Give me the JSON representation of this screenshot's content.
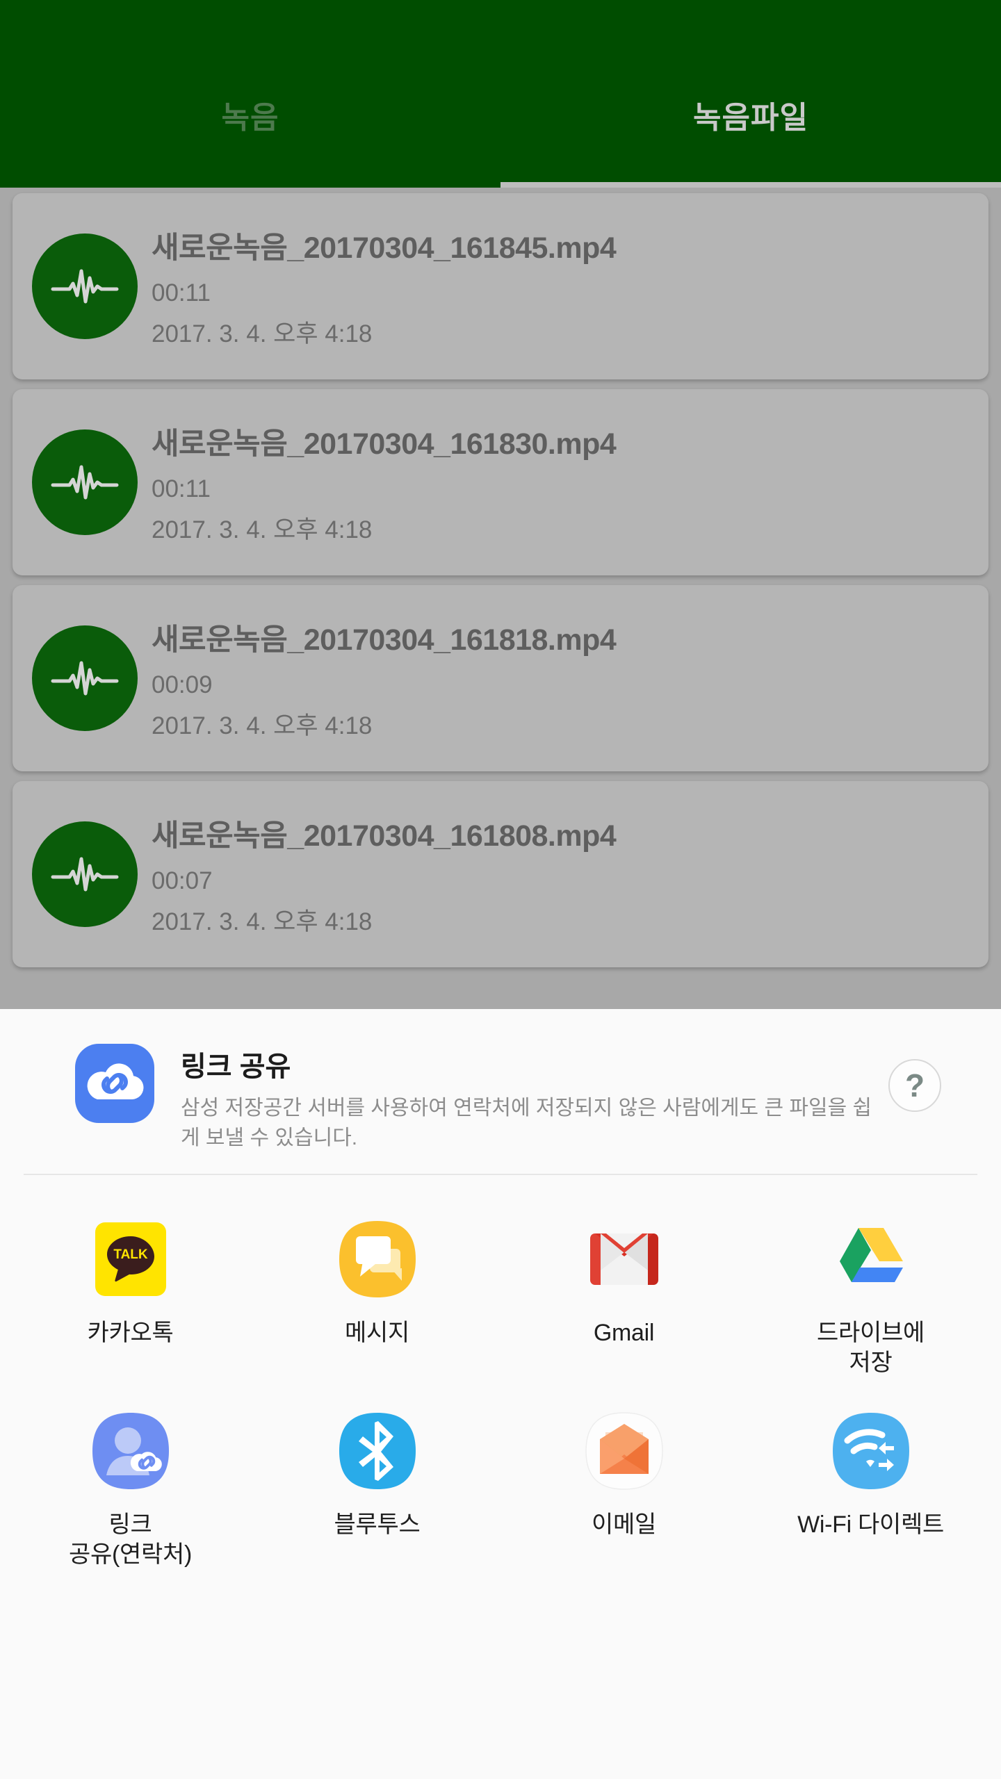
{
  "header": {
    "tabs": [
      {
        "label": "녹음",
        "active": false
      },
      {
        "label": "녹음파일",
        "active": true
      }
    ]
  },
  "colors": {
    "header_green": "#004d00",
    "icon_green": "#0a5c0a",
    "card_gray": "#b5b5b5",
    "page_gray": "#a8a8a8",
    "sheet_bg": "#fafafa",
    "tab_active": "#c9c9c9",
    "tab_inactive": "#4d7a4d"
  },
  "recordings": [
    {
      "name": "새로운녹음_20170304_161845.mp4",
      "duration": "00:11",
      "date": "2017. 3. 4. 오후 4:18",
      "icon": "waveform-icon"
    },
    {
      "name": "새로운녹음_20170304_161830.mp4",
      "duration": "00:11",
      "date": "2017. 3. 4. 오후 4:18",
      "icon": "waveform-icon"
    },
    {
      "name": "새로운녹음_20170304_161818.mp4",
      "duration": "00:09",
      "date": "2017. 3. 4. 오후 4:18",
      "icon": "waveform-icon"
    },
    {
      "name": "새로운녹음_20170304_161808.mp4",
      "duration": "00:07",
      "date": "2017. 3. 4. 오후 4:18",
      "icon": "waveform-icon"
    }
  ],
  "share_sheet": {
    "link_share": {
      "title": "링크 공유",
      "description": "삼성 저장공간 서버를 사용하여 연락처에 저장되지 않은 사람에게도 큰 파일을 쉽게 보낼 수 있습니다.",
      "icon": "cloud-link-icon",
      "help_label": "?"
    },
    "apps": [
      {
        "label": "카카오톡",
        "icon": "kakaotalk-icon"
      },
      {
        "label": "메시지",
        "icon": "messages-icon"
      },
      {
        "label": "Gmail",
        "icon": "gmail-icon"
      },
      {
        "label": "드라이브에\n저장",
        "icon": "google-drive-icon"
      },
      {
        "label": "링크\n공유(연락처)",
        "icon": "link-share-contacts-icon"
      },
      {
        "label": "블루투스",
        "icon": "bluetooth-icon"
      },
      {
        "label": "이메일",
        "icon": "email-icon"
      },
      {
        "label": "Wi-Fi 다이렉트",
        "icon": "wifi-direct-icon"
      }
    ]
  }
}
